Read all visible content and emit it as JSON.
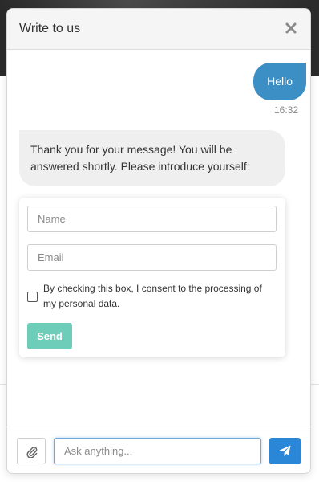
{
  "header": {
    "title": "Write to us"
  },
  "icons": {
    "close": "close-icon",
    "attach": "paperclip-icon",
    "send": "paper-plane-icon"
  },
  "messages": {
    "outgoing": {
      "text": "Hello",
      "time": "16:32"
    },
    "incoming": {
      "text": "Thank you for your message! You will be answered shortly. Please introduce yourself:"
    }
  },
  "intro_form": {
    "name_placeholder": "Name",
    "name_value": "",
    "email_placeholder": "Email",
    "email_value": "",
    "consent_text": "By checking this box, I consent to the processing of my personal data.",
    "consent_checked": false,
    "send_label": "Send"
  },
  "composer": {
    "placeholder": "Ask anything...",
    "value": ""
  },
  "colors": {
    "outgoing_bubble": "#3b8fc4",
    "incoming_bubble": "#efefef",
    "form_send_button": "#6dcdb8",
    "send_button": "#2a86d6"
  }
}
